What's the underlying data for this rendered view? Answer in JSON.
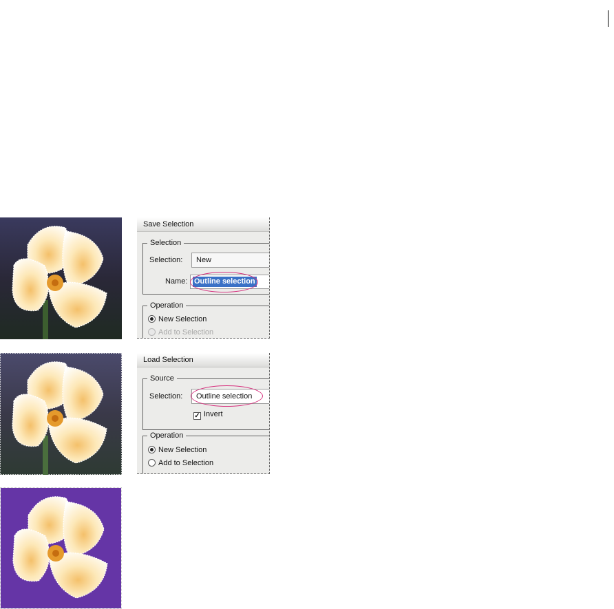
{
  "save_dialog": {
    "title": "Save Selection",
    "selection_group": "Selection",
    "selection_label": "Selection:",
    "selection_value": "New",
    "name_label": "Name:",
    "name_value": "Outline selection",
    "operation_group": "Operation",
    "radio_new": "New Selection",
    "radio_add": "Add to Selection"
  },
  "load_dialog": {
    "title": "Load Selection",
    "source_group": "Source",
    "selection_label": "Selection:",
    "selection_value": "Outline selection",
    "invert_label": "Invert",
    "invert_checked": true,
    "operation_group": "Operation",
    "radio_new": "New Selection",
    "radio_add": "Add to Selection"
  },
  "colors": {
    "highlight": "#d6317e",
    "selection_blue": "#3a71c6",
    "purple_background": "#6535a6"
  }
}
